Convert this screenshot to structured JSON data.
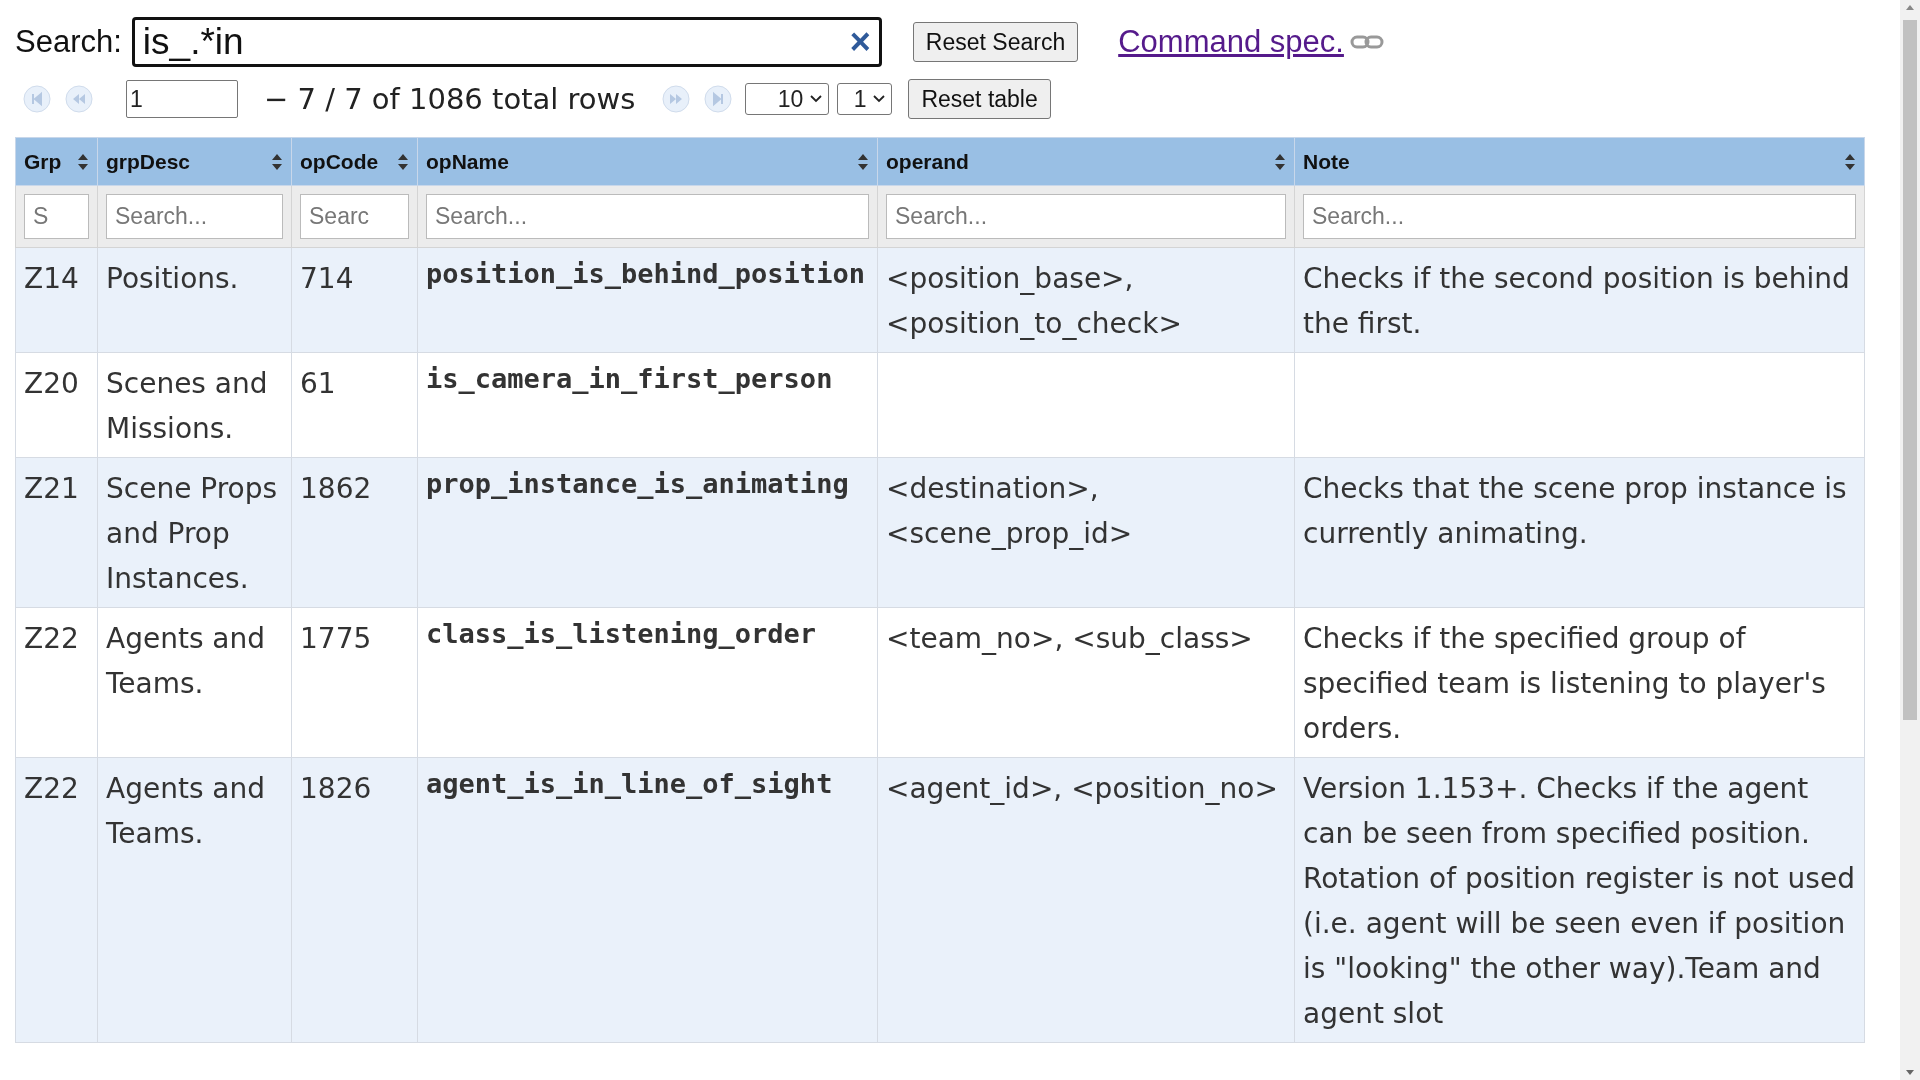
{
  "search": {
    "label": "Search:",
    "value": "is_.*in",
    "clear": "×"
  },
  "reset_search": "Reset Search",
  "link": {
    "label": "Command spec."
  },
  "pager": {
    "page": "1",
    "range_text": "− 7 / 7 of 1086 total rows",
    "page_size": "10",
    "page_select": "1",
    "reset": "Reset table"
  },
  "columns": [
    {
      "label": "Grp",
      "placeholder": "S"
    },
    {
      "label": "grpDesc",
      "placeholder": "Search..."
    },
    {
      "label": "opCode",
      "placeholder": "Searc"
    },
    {
      "label": "opName",
      "placeholder": "Search..."
    },
    {
      "label": "operand",
      "placeholder": "Search..."
    },
    {
      "label": "Note",
      "placeholder": "Search..."
    }
  ],
  "rows": [
    {
      "grp": "Z14",
      "grpDesc": "Positions.",
      "opCode": "714",
      "opName": "position_is_behind_position",
      "operand": "<position_base>, <position_to_check>",
      "note": "Checks if the second position is behind the first."
    },
    {
      "grp": "Z20",
      "grpDesc": "Scenes and Missions.",
      "opCode": "61",
      "opName": "is_camera_in_first_person"
    },
    {
      "grp": "Z21",
      "grpDesc": "Scene Props and Prop Instances.",
      "opCode": "1862",
      "opName": "prop_instance_is_animating",
      "operand": "<destination>, <scene_prop_id>",
      "note": "Checks that the scene prop instance is currently animating."
    },
    {
      "grp": "Z22",
      "grpDesc": "Agents and Teams.",
      "opCode": "1775",
      "opName": "class_is_listening_order",
      "operand": "<team_no>, <sub_class>",
      "note": "Checks if the specified group of specified team is listening to player's orders."
    },
    {
      "grp": "Z22",
      "grpDesc": "Agents and Teams.",
      "opCode": "1826",
      "opName": "agent_is_in_line_of_sight",
      "operand": "<agent_id>, <position_no>",
      "note": "Version 1.153+. Checks if the agent can be seen from specified position. Rotation of position register is not used (i.e. agent will be seen even if position is \"looking\" the other way).Team and agent slot"
    }
  ]
}
